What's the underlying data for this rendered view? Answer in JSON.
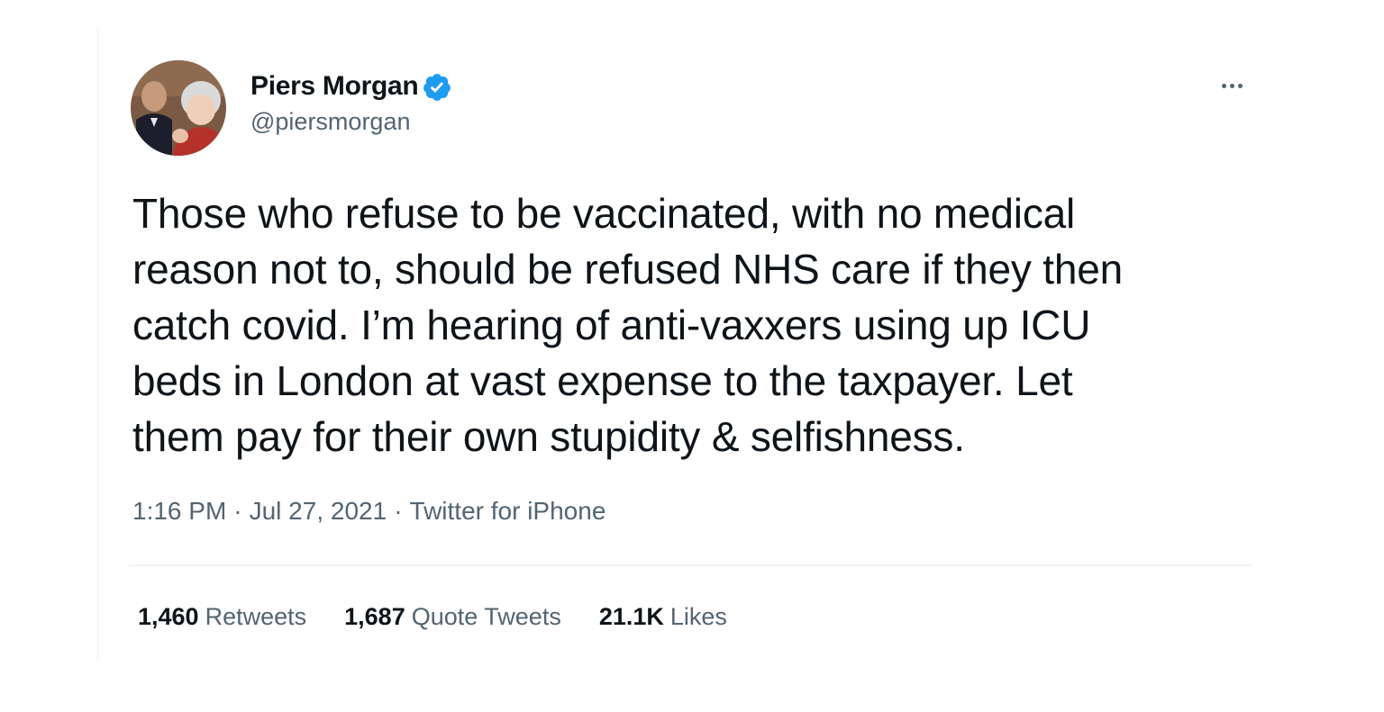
{
  "author": {
    "display_name": "Piers Morgan",
    "handle": "@piersmorgan",
    "verified": true,
    "verified_color": "#1d9bf0",
    "avatar_icon": "profile-photo"
  },
  "menu": {
    "more_icon": "ellipsis-icon"
  },
  "tweet": {
    "text": "Those who refuse to be vaccinated, with no medical\nreason not to, should be refused NHS care if they then\ncatch covid. I’m hearing of anti-vaxxers using up ICU\nbeds in London at vast expense to the taxpayer. Let\nthem pay for their own stupidity & selfishness.",
    "time": "1:16 PM",
    "separator": "·",
    "date": "Jul 27, 2021",
    "source": "Twitter for iPhone"
  },
  "stats": {
    "retweets_count": "1,460",
    "retweets_label": "Retweets",
    "quotes_count": "1,687",
    "quotes_label": "Quote Tweets",
    "likes_count": "21.1K",
    "likes_label": "Likes"
  },
  "colors": {
    "primary_text": "#0f1419",
    "secondary_text": "#536471",
    "divider": "#eff3f4"
  }
}
